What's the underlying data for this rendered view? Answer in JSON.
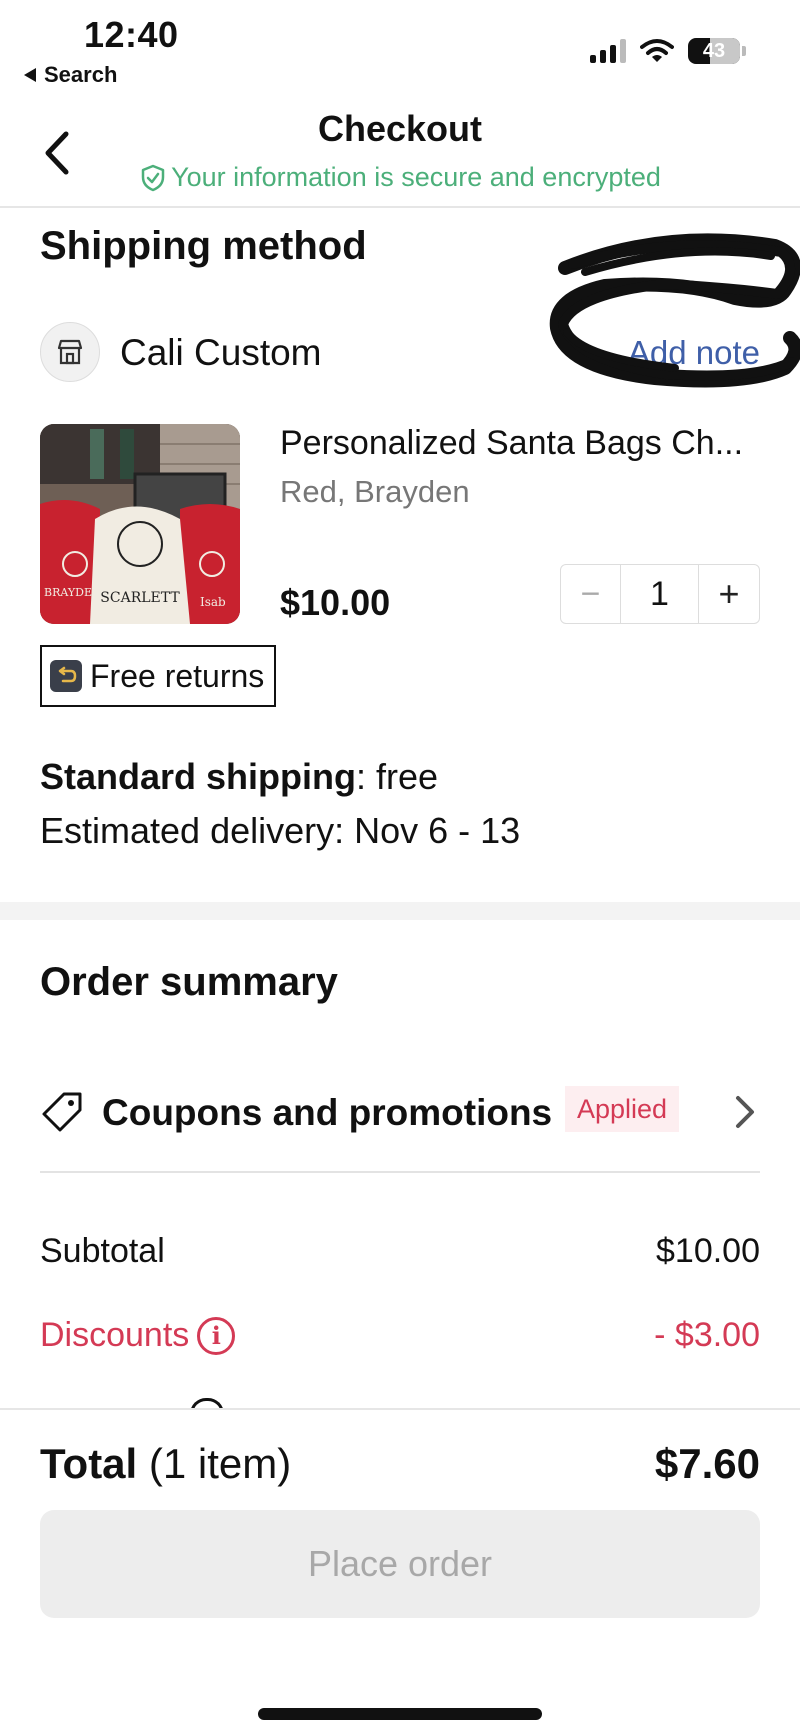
{
  "status_bar": {
    "time": "12:40",
    "back_label": "Search",
    "battery": "43"
  },
  "header": {
    "title": "Checkout",
    "secure_text": "Your information is secure and encrypted"
  },
  "shipping": {
    "section_title": "Shipping method",
    "store_name": "Cali Custom",
    "add_note_label": "Add note",
    "product": {
      "name": "Personalized Santa Bags Ch...",
      "variant": "Red, Brayden",
      "price": "$10.00",
      "quantity": "1",
      "qty_minus": "−",
      "qty_plus": "+"
    },
    "free_returns": "Free returns",
    "shipping_method_label": "Standard shipping",
    "shipping_cost": ": free",
    "delivery": "Estimated delivery: Nov 6 - 13"
  },
  "summary": {
    "section_title": "Order summary",
    "coupons_label": "Coupons and promotions",
    "applied_badge": "Applied",
    "subtotal_label": "Subtotal",
    "subtotal_value": "$10.00",
    "discounts_label": "Discounts",
    "discounts_value": "- $3.00",
    "info_glyph": "i"
  },
  "footer": {
    "total_label": "Total",
    "total_items": " (1 item)",
    "total_value": "$7.60",
    "place_order_label": "Place order"
  },
  "colors": {
    "secure_green": "#4caf7a",
    "link_blue": "#3f5fa8",
    "discount_red": "#d43a55"
  }
}
